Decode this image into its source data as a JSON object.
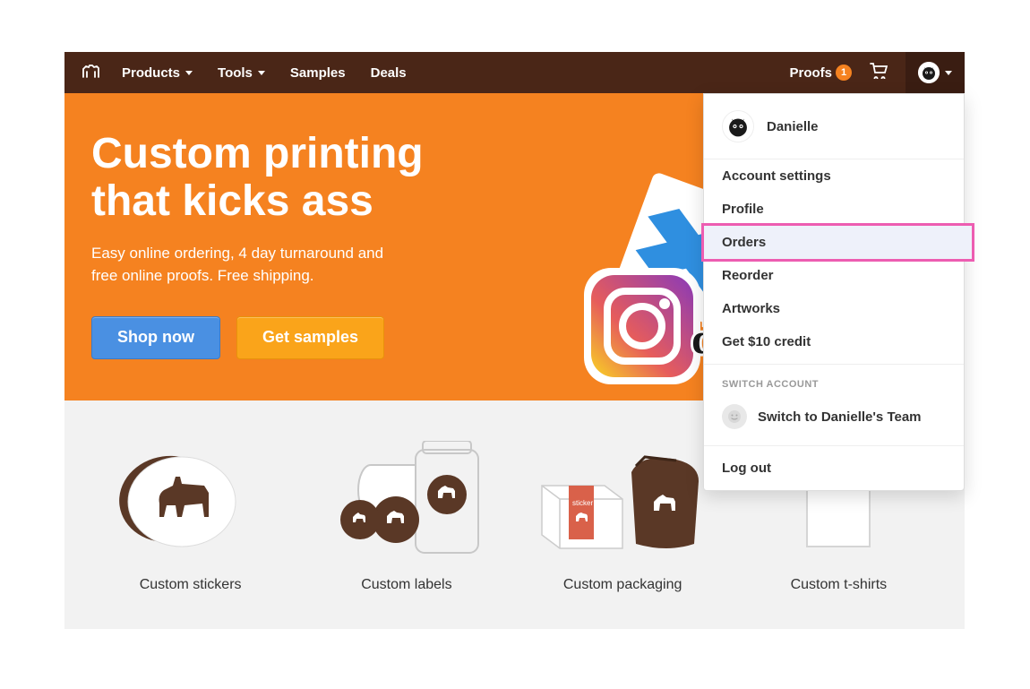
{
  "nav": {
    "items": [
      {
        "label": "Products",
        "has_dropdown": true
      },
      {
        "label": "Tools",
        "has_dropdown": true
      },
      {
        "label": "Samples",
        "has_dropdown": false
      },
      {
        "label": "Deals",
        "has_dropdown": false
      }
    ],
    "proofs": {
      "label": "Proofs",
      "badge": "1"
    }
  },
  "hero": {
    "title_line1": "Custom printing",
    "title_line2": "that kicks ass",
    "subtitle_line1": "Easy online ordering, 4 day turnaround and",
    "subtitle_line2": "free online proofs. Free shipping.",
    "shop_button": "Shop now",
    "samples_button": "Get samples"
  },
  "categories": [
    {
      "label": "Custom stickers"
    },
    {
      "label": "Custom labels"
    },
    {
      "label": "Custom packaging"
    },
    {
      "label": "Custom t-shirts"
    }
  ],
  "dropdown": {
    "username": "Danielle",
    "items": [
      "Account settings",
      "Profile",
      "Orders",
      "Reorder",
      "Artworks",
      "Get $10 credit"
    ],
    "highlighted_index": 2,
    "switch_label": "SWITCH ACCOUNT",
    "switch_prefix": "Switch to ",
    "switch_team": "Danielle's Team",
    "logout": "Log out"
  },
  "colors": {
    "brand_orange": "#f58220",
    "nav_brown": "#4a2617",
    "btn_blue": "#4a90e2",
    "highlight_pink": "#ed5db1"
  }
}
